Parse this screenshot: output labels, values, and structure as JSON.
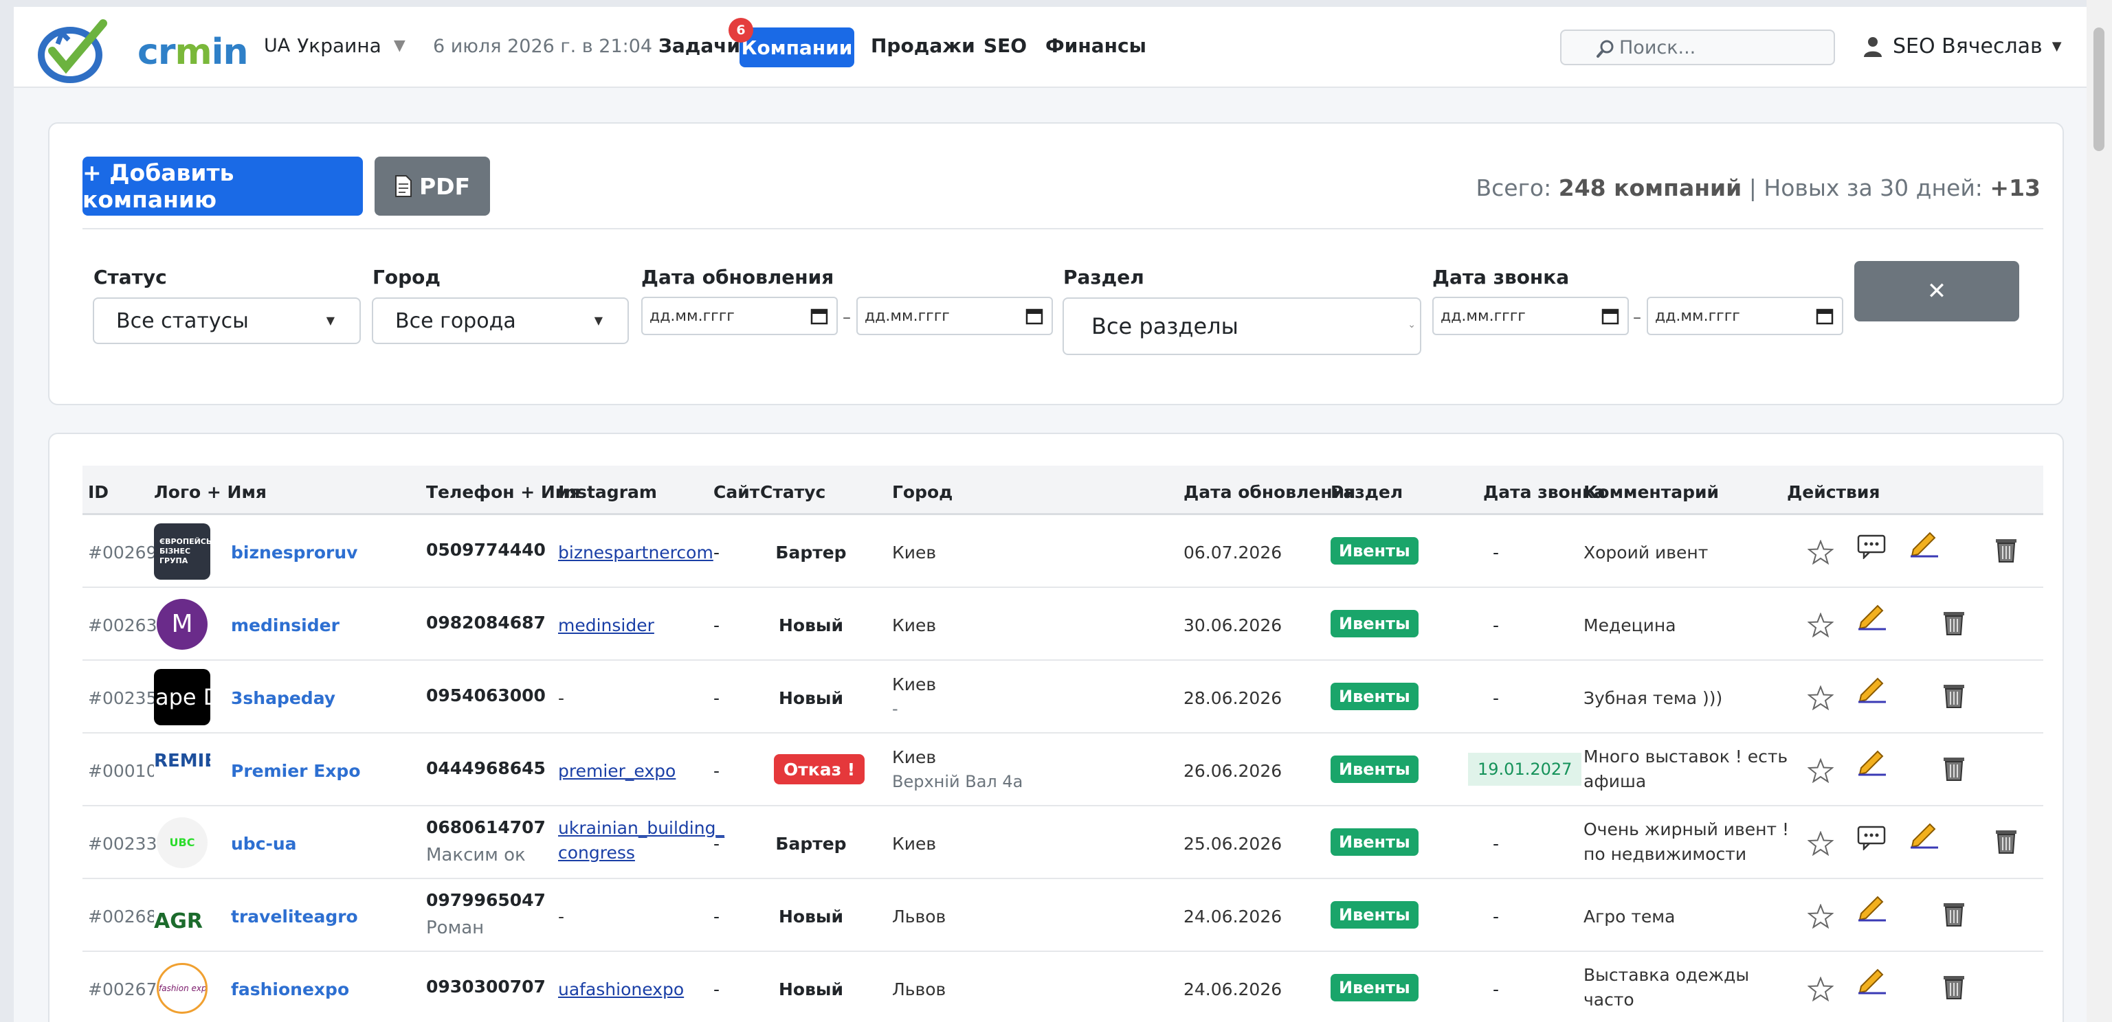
{
  "navbar": {
    "brand": "crmin",
    "country_code": "UA",
    "country": "Украина",
    "datetime": "6 июля 2026 г. в 21:04",
    "links": [
      "Задачи",
      "Компании",
      "Продажи",
      "SEO",
      "Финансы"
    ],
    "active_link": "Компании",
    "tasks_badge": "6",
    "search_placeholder": "Поиск...",
    "user": "SEO Вячеслав"
  },
  "toolbar": {
    "add_button": "+ Добавить компанию",
    "pdf_button": "PDF",
    "totals_prefix": "Всего:",
    "totals_count": "248 компаний",
    "totals_sep": "|",
    "totals_new_label": "Новых за 30 дней:",
    "totals_new": "+13"
  },
  "filters": {
    "status_label": "Статус",
    "status_value": "Все статусы",
    "city_label": "Город",
    "city_value": "Все города",
    "updated_label": "Дата обновления",
    "date_placeholder": "дд.мм.гггг",
    "section_label": "Раздел",
    "section_value": "Все разделы",
    "call_label": "Дата звонка",
    "range_sep": "–",
    "clear_button": "✕"
  },
  "table": {
    "headers": [
      "ID",
      "Лого + Имя",
      "Телефон + Имя",
      "Instagram",
      "Сайт",
      "Статус",
      "Город",
      "Дата обновления",
      "Раздел",
      "Дата звонка",
      "Комментарий",
      "Действия"
    ],
    "rows": [
      {
        "id": "#00269",
        "name": "biznesproruv",
        "phone": "0509774440",
        "contact": "",
        "instagram": "biznespartnercom",
        "instagram2": "",
        "site": "-",
        "status": "Бартер",
        "city": "Киев",
        "address": "",
        "updated": "06.07.2026",
        "section": "Ивенты",
        "call_date": "-",
        "comment": "Хороий ивент",
        "comment2": "",
        "logo_text": "ЄВРОПЕЙСЬКА БІЗНЕС ГРУПА"
      },
      {
        "id": "#00263",
        "name": "medinsider",
        "phone": "0982084687",
        "contact": "",
        "instagram": "medinsider",
        "instagram2": "",
        "site": "-",
        "status": "Новый",
        "city": "Киев",
        "address": "",
        "updated": "30.06.2026",
        "section": "Ивенты",
        "call_date": "-",
        "comment": "Медецина",
        "comment2": "",
        "logo_text": "M"
      },
      {
        "id": "#00235",
        "name": "3shapeday",
        "phone": "0954063000",
        "contact": "",
        "instagram": "-",
        "instagram2": "",
        "site": "-",
        "status": "Новый",
        "city": "Киев",
        "address": "-",
        "updated": "28.06.2026",
        "section": "Ивенты",
        "call_date": "-",
        "comment": "Зубная тема )))",
        "comment2": "",
        "logo_text": "ape D"
      },
      {
        "id": "#00010",
        "name": "Premier Expo",
        "phone": "0444968645",
        "contact": "",
        "instagram": "premier_expo",
        "instagram2": "",
        "site": "-",
        "status": "Отказ !",
        "city": "Киев",
        "address": "Верхній Вал 4а",
        "updated": "26.06.2026",
        "section": "Ивенты",
        "call_date": "19.01.2027",
        "comment": "Много выставок ! есть",
        "comment2": "афиша",
        "logo_text": "REMIE"
      },
      {
        "id": "#00233",
        "name": "ubc-ua",
        "phone": "0680614707",
        "contact": "Максим ок",
        "instagram": "ukrainian_building_",
        "instagram2": "congress",
        "site": "-",
        "status": "Бартер",
        "city": "Киев",
        "address": "",
        "updated": "25.06.2026",
        "section": "Ивенты",
        "call_date": "-",
        "comment": "Очень жирный ивент !",
        "comment2": "по недвижимости",
        "logo_text": "UBC"
      },
      {
        "id": "#00268",
        "name": "traveliteagro",
        "phone": "0979965047",
        "contact": "Роман",
        "instagram": "-",
        "instagram2": "",
        "site": "-",
        "status": "Новый",
        "city": "Львов",
        "address": "",
        "updated": "24.06.2026",
        "section": "Ивенты",
        "call_date": "-",
        "comment": "Агро тема",
        "comment2": "",
        "logo_text": "AGR"
      },
      {
        "id": "#00267",
        "name": "fashionexpo",
        "phone": "0930300707",
        "contact": "",
        "instagram": "uafashionexpo",
        "instagram2": "",
        "site": "-",
        "status": "Новый",
        "city": "Львов",
        "address": "",
        "updated": "24.06.2026",
        "section": "Ивенты",
        "call_date": "-",
        "comment": "Выставка одежды",
        "comment2": "часто",
        "logo_text": "fashion expo"
      }
    ]
  }
}
